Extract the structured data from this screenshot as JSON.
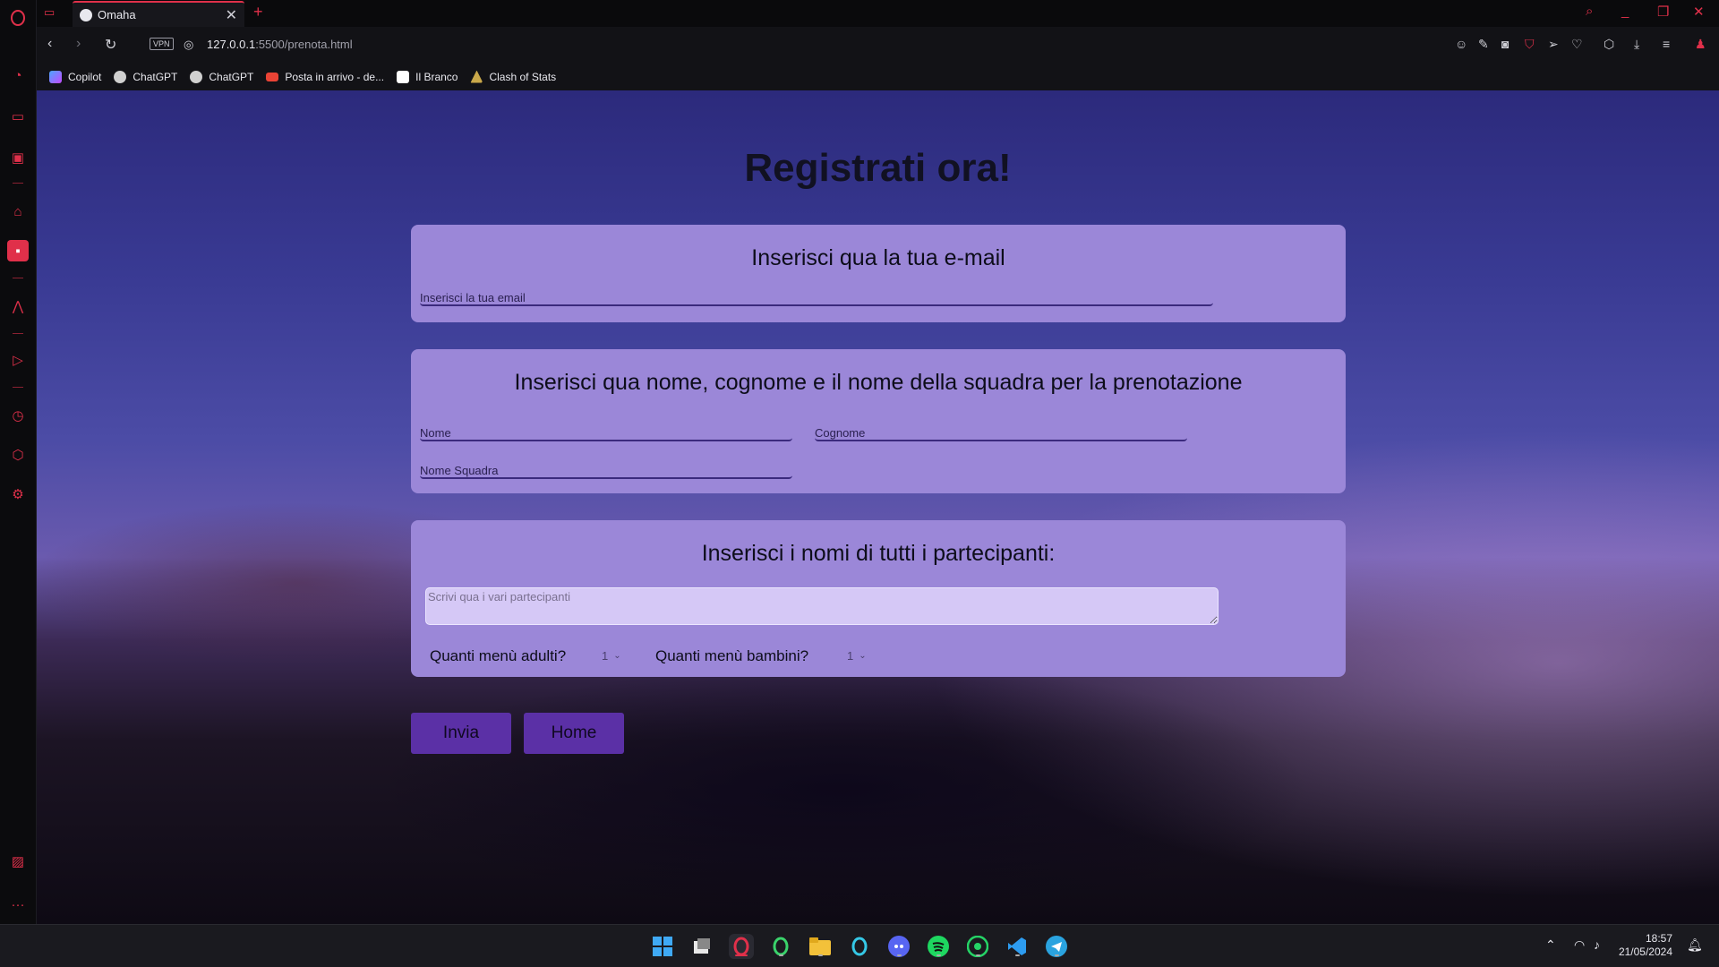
{
  "browser": {
    "tab_title": "Omaha",
    "new_tab_label": "+",
    "vpn_label": "VPN",
    "url_host": "127.0.0.1",
    "url_rest": ":5500/prenota.html",
    "bookmarks": [
      {
        "label": "Copilot",
        "color": "#4aa6ff"
      },
      {
        "label": "ChatGPT",
        "color": "#d0d0d0"
      },
      {
        "label": "ChatGPT",
        "color": "#d0d0d0"
      },
      {
        "label": "Posta in arrivo - de...",
        "color": "#ea4335"
      },
      {
        "label": "Il Branco",
        "color": "#ffffff"
      },
      {
        "label": "Clash of Stats",
        "color": "#c9a84a"
      }
    ]
  },
  "page": {
    "title": "Registrati ora!",
    "email_section": {
      "heading": "Inserisci qua la tua e-mail",
      "email_placeholder": "Inserisci la tua email"
    },
    "name_section": {
      "heading": "Inserisci qua nome, cognome e il nome della squadra per la prenotazione",
      "first_name_placeholder": "Nome",
      "last_name_placeholder": "Cognome",
      "team_placeholder": "Nome Squadra"
    },
    "participants_section": {
      "heading": "Inserisci i nomi di tutti i partecipanti:",
      "textarea_placeholder": "Scrivi qua i vari partecipanti",
      "adult_label": "Quanti menù adulti?",
      "adult_value": "1",
      "child_label": "Quanti menù bambini?",
      "child_value": "1"
    },
    "submit_label": "Invia",
    "home_label": "Home"
  },
  "taskbar": {
    "time": "18:57",
    "date": "21/05/2024"
  },
  "colors": {
    "accent": "#e0304a",
    "card_bg": "#9b87d8",
    "button_bg": "#5b30a6"
  }
}
